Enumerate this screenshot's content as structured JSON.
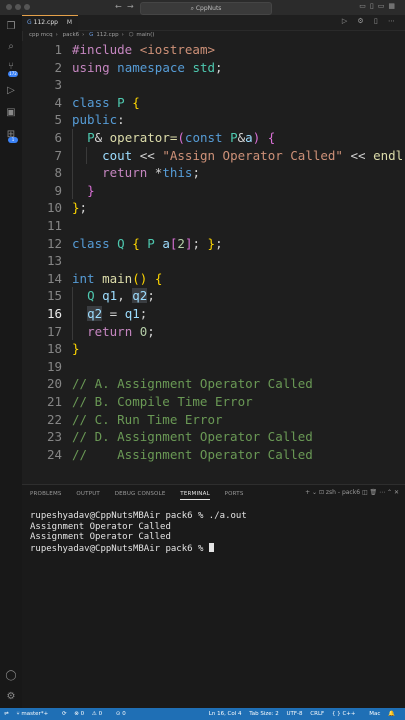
{
  "window": {
    "search_text": "CppNuts"
  },
  "tab": {
    "filename": "112.cpp",
    "modified_flag": "M",
    "lang_glyph": "G"
  },
  "breadcrumb": [
    "cpp mcq",
    "pack6",
    "112.cpp",
    "main()"
  ],
  "activity_badges": {
    "source_control": "172",
    "extensions": "1"
  },
  "code_lines": [
    {
      "n": "1",
      "html": "<span class='kw2'>#include</span> <span class='inc'>&lt;iostream&gt;</span>"
    },
    {
      "n": "2",
      "html": "<span class='kw2'>using</span> <span class='kw'>namespace</span> <span class='ty'>std</span><span class='pl'>;</span>"
    },
    {
      "n": "3",
      "html": ""
    },
    {
      "n": "4",
      "html": "<span class='kw'>class</span> <span class='ty'>P</span> <span class='br1'>{</span>"
    },
    {
      "n": "5",
      "html": "<span class='kw'>public</span><span class='pl'>:</span>"
    },
    {
      "n": "6",
      "html": "  <span class='ty'>P</span><span class='pl'>&amp;</span> <span class='fn'>operator=</span><span class='br2'>(</span><span class='kw'>const</span> <span class='ty'>P</span><span class='pl'>&amp;</span><span class='var'>a</span><span class='br2'>)</span> <span class='br2'>{</span>"
    },
    {
      "n": "7",
      "html": "    <span class='var'>cout</span> <span class='pl'>&lt;&lt;</span> <span class='str'>\"Assign Operator Called\"</span> <span class='pl'>&lt;&lt;</span> <span class='fn'>endl</span><span class='pl'>;</span>"
    },
    {
      "n": "8",
      "html": "    <span class='kw2'>return</span> <span class='pl'>*</span><span class='kw'>this</span><span class='pl'>;</span>"
    },
    {
      "n": "9",
      "html": "  <span class='br2'>}</span>"
    },
    {
      "n": "10",
      "html": "<span class='br1'>}</span><span class='pl'>;</span>"
    },
    {
      "n": "11",
      "html": ""
    },
    {
      "n": "12",
      "html": "<span class='kw'>class</span> <span class='ty'>Q</span> <span class='br1'>{</span> <span class='ty'>P</span> <span class='var'>a</span><span class='br2'>[</span><span class='num'>2</span><span class='br2'>]</span><span class='pl'>;</span> <span class='br1'>}</span><span class='pl'>;</span>"
    },
    {
      "n": "13",
      "html": ""
    },
    {
      "n": "14",
      "html": "<span class='kw'>int</span> <span class='fn'>main</span><span class='br1'>()</span> <span class='br1'>{</span>"
    },
    {
      "n": "15",
      "html": "  <span class='ty'>Q</span> <span class='var'>q1</span><span class='pl'>,</span> <span class='var hl'>q2</span><span class='pl'>;</span>"
    },
    {
      "n": "16",
      "html": "  <span class='var hl'>q2</span> <span class='pl'>=</span> <span class='var'>q1</span><span class='pl'>;</span>"
    },
    {
      "n": "17",
      "html": "  <span class='kw2'>return</span> <span class='num'>0</span><span class='pl'>;</span>"
    },
    {
      "n": "18",
      "html": "<span class='br1'>}</span>"
    },
    {
      "n": "19",
      "html": ""
    },
    {
      "n": "20",
      "html": "<span class='cm'>// A. Assignment Operator Called</span>"
    },
    {
      "n": "21",
      "html": "<span class='cm'>// B. Compile Time Error</span>"
    },
    {
      "n": "22",
      "html": "<span class='cm'>// C. Run Time Error</span>"
    },
    {
      "n": "23",
      "html": "<span class='cm'>// D. Assignment Operator Called</span>"
    },
    {
      "n": "24",
      "html": "<span class='cm'>//    Assignment Operator Called</span>"
    }
  ],
  "active_line": "16",
  "panel": {
    "tabs": [
      "PROBLEMS",
      "OUTPUT",
      "DEBUG CONSOLE",
      "TERMINAL",
      "PORTS"
    ],
    "active_tab": "TERMINAL",
    "shell_label": "zsh - pack6",
    "terminal_lines": [
      "rupeshyadav@CppNutsMBAir pack6 % ./a.out",
      "Assignment Operator Called",
      "Assignment Operator Called",
      "rupeshyadav@CppNutsMBAir pack6 % "
    ]
  },
  "status": {
    "branch": "master*+",
    "errors": "0",
    "warnings": "0",
    "ports": "0",
    "position": "Ln 16, Col 4",
    "tab_size": "Tab Size: 2",
    "encoding": "UTF-8",
    "eol": "CRLF",
    "language": "C++",
    "platform": "Mac"
  }
}
